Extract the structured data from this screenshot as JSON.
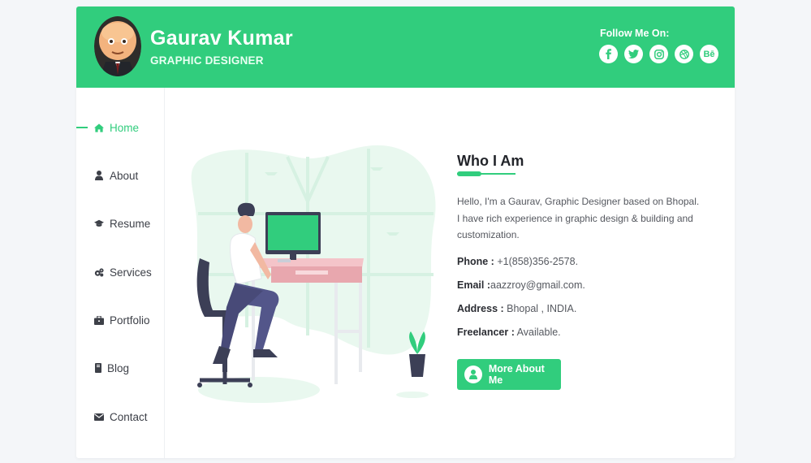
{
  "header": {
    "name": "Gaurav Kumar",
    "role": "GRAPHIC DESIGNER",
    "follow_label": "Follow Me On:",
    "socials": [
      {
        "icon": "facebook-icon",
        "glyph": "f"
      },
      {
        "icon": "twitter-icon",
        "glyph": ""
      },
      {
        "icon": "instagram-icon",
        "glyph": ""
      },
      {
        "icon": "dribbble-icon",
        "glyph": ""
      },
      {
        "icon": "behance-icon",
        "glyph": "Bē"
      }
    ]
  },
  "nav": {
    "items": [
      {
        "label": "Home",
        "icon": "home-icon",
        "active": true
      },
      {
        "label": "About",
        "icon": "user-icon",
        "active": false
      },
      {
        "label": "Resume",
        "icon": "graduation-cap-icon",
        "active": false
      },
      {
        "label": "Services",
        "icon": "cogs-icon",
        "active": false
      },
      {
        "label": "Portfolio",
        "icon": "briefcase-icon",
        "active": false
      },
      {
        "label": "Blog",
        "icon": "book-icon",
        "active": false
      },
      {
        "label": "Contact",
        "icon": "envelope-icon",
        "active": false
      }
    ]
  },
  "about": {
    "title": "Who I Am",
    "bio": "Hello, I'm a Gaurav, Graphic Designer based on Bhopal. I have rich experience in graphic design & building and customization.",
    "phone_label": "Phone :",
    "phone": "+1(858)356-2578.",
    "email_label": "Email :",
    "email": "aazzroy@gmail.com.",
    "address_label": "Address :",
    "address": "Bhopal , INDIA.",
    "freelancer_label": "Freelancer :",
    "freelancer": "Available.",
    "button": "More About Me"
  },
  "colors": {
    "accent": "#31cd7d",
    "text": "#3d4048",
    "background": "#f4f6f9"
  }
}
